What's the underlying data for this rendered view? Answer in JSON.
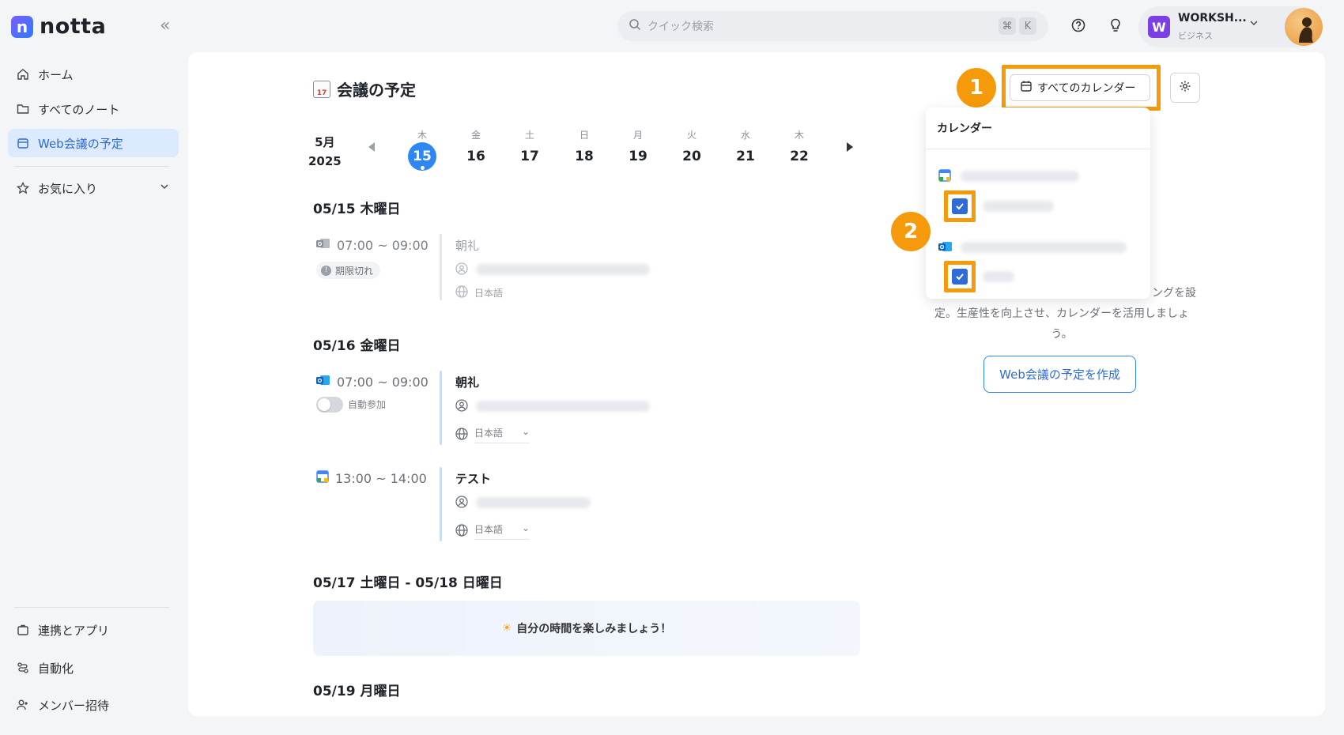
{
  "app": {
    "brand": "notta"
  },
  "sidebar": {
    "items": [
      {
        "label": "ホーム"
      },
      {
        "label": "すべてのノート"
      },
      {
        "label": "Web会議の予定"
      },
      {
        "label": "お気に入り"
      }
    ],
    "bottom": [
      {
        "label": "連携とアプリ"
      },
      {
        "label": "自動化"
      },
      {
        "label": "メンバー招待"
      }
    ]
  },
  "topbar": {
    "search_placeholder": "クイック検索",
    "shortcut_key1": "⌘",
    "shortcut_key2": "K",
    "workspace": {
      "initial": "W",
      "name": "WORKSH...",
      "plan": "ビジネス"
    }
  },
  "main": {
    "title": "会議の予定",
    "month": "5月",
    "year": "2025",
    "days": [
      {
        "wd": "木",
        "d": "15"
      },
      {
        "wd": "金",
        "d": "16"
      },
      {
        "wd": "土",
        "d": "17"
      },
      {
        "wd": "日",
        "d": "18"
      },
      {
        "wd": "月",
        "d": "19"
      },
      {
        "wd": "火",
        "d": "20"
      },
      {
        "wd": "水",
        "d": "21"
      },
      {
        "wd": "木",
        "d": "22"
      }
    ],
    "sections": {
      "s1": "05/15 木曜日",
      "s2": "05/16 金曜日",
      "s3": "05/17 土曜日 - 05/18 日曜日",
      "s4": "05/19 月曜日"
    },
    "events": {
      "e1": {
        "time": "07:00 ~ 09:00",
        "title": "朝礼",
        "badge": "期限切れ",
        "lang": "日本語"
      },
      "e2": {
        "time": "07:00 ~ 09:00",
        "title": "朝礼",
        "toggle": "自動参加",
        "lang": "日本語"
      },
      "e3": {
        "time": "13:00 ~ 14:00",
        "title": "テスト",
        "lang": "日本語"
      }
    },
    "weekend_message": "自分の時間を楽しみましょう！"
  },
  "right": {
    "all_calendars_button": "すべてのカレンダー",
    "popup_header": "カレンダー",
    "step1": "1",
    "step2": "2",
    "empty_line1": "ングを設",
    "empty_line2": "定。生産性を向上させ、カレンダーを活用しましょ",
    "empty_line3": "う。",
    "create_button": "Web会議の予定を作成"
  },
  "colors": {
    "accent": "#2f87f5",
    "highlight": "#f59a0b",
    "active_bg": "#dbeafe"
  }
}
